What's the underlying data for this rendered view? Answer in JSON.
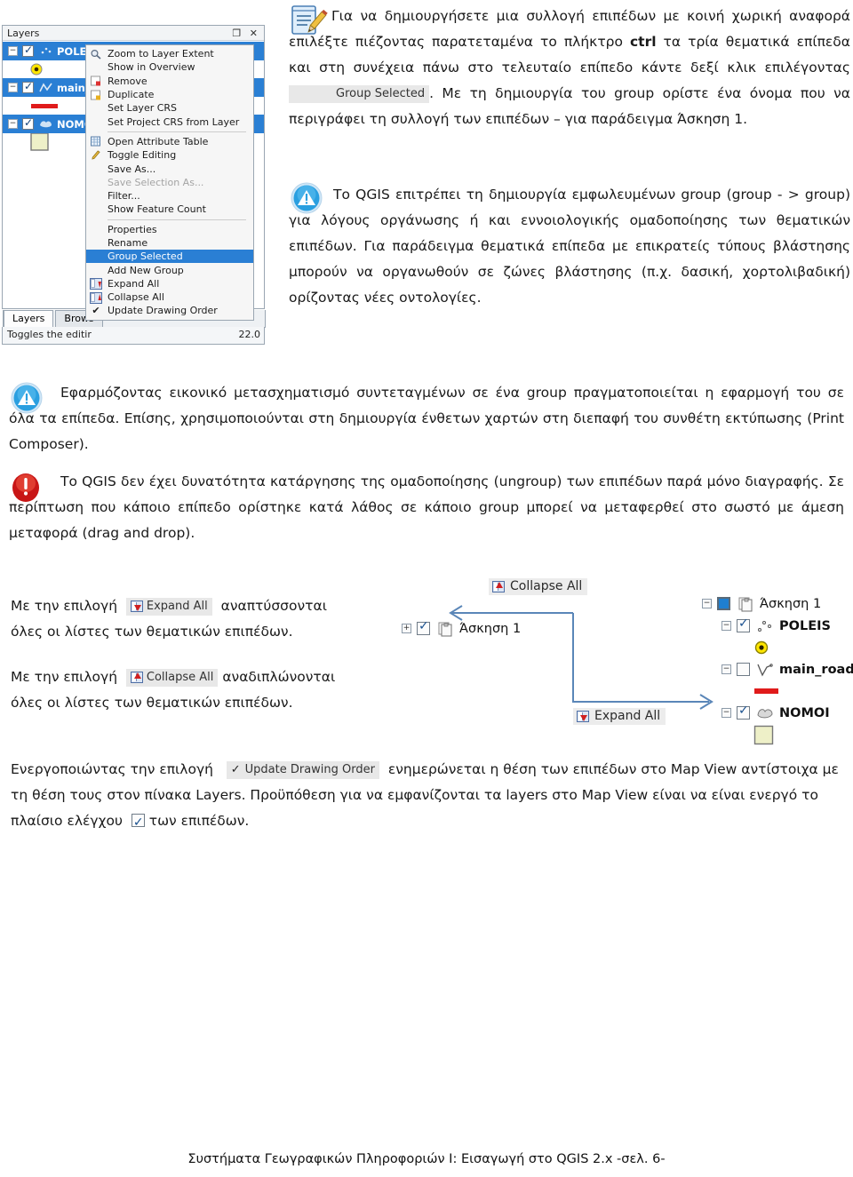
{
  "qgis_panel": {
    "title": "Layers",
    "win_buttons": "❐ ✕",
    "layers": [
      {
        "name": "POLEI",
        "icon": "point-layer-icon",
        "selected": true,
        "symbol": "point-symbol"
      },
      {
        "name": "main_",
        "icon": "line-layer-icon",
        "selected": true,
        "symbol": "line-symbol"
      },
      {
        "name": "NOMO",
        "icon": "polygon-layer-icon",
        "selected": true,
        "symbol": "polygon-symbol"
      }
    ],
    "tabs": [
      "Layers",
      "Brows"
    ],
    "status_left": "Toggles the editir",
    "status_right": "22.0"
  },
  "context_menu": {
    "items": [
      {
        "label": "Zoom to Layer Extent",
        "icon": "magnifier-icon",
        "state": "normal"
      },
      {
        "label": "Show in Overview",
        "icon": "",
        "state": "normal"
      },
      {
        "label": "Remove",
        "icon": "remove-icon",
        "state": "normal"
      },
      {
        "label": "Duplicate",
        "icon": "duplicate-icon",
        "state": "normal"
      },
      {
        "label": "Set Layer CRS",
        "icon": "",
        "state": "normal"
      },
      {
        "label": "Set Project CRS from Layer",
        "icon": "",
        "state": "normal"
      },
      {
        "separator": true
      },
      {
        "label": "Open Attribute Table",
        "icon": "table-icon",
        "state": "normal"
      },
      {
        "label": "Toggle Editing",
        "icon": "pencil-icon",
        "state": "normal"
      },
      {
        "label": "Save As...",
        "icon": "",
        "state": "normal"
      },
      {
        "label": "Save Selection As...",
        "icon": "",
        "state": "disabled"
      },
      {
        "label": "Filter...",
        "icon": "",
        "state": "normal"
      },
      {
        "label": "Show Feature Count",
        "icon": "",
        "state": "normal"
      },
      {
        "separator": true
      },
      {
        "label": "Properties",
        "icon": "",
        "state": "normal"
      },
      {
        "label": "Rename",
        "icon": "",
        "state": "normal"
      },
      {
        "label": "Group Selected",
        "icon": "",
        "state": "highlighted"
      },
      {
        "label": "Add New Group",
        "icon": "",
        "state": "normal"
      },
      {
        "label": "Expand All",
        "icon": "expand-all-icon",
        "state": "normal"
      },
      {
        "label": "Collapse All",
        "icon": "collapse-all-icon",
        "state": "normal"
      },
      {
        "label": "Update Drawing Order",
        "icon": "check-mark",
        "state": "checked"
      }
    ]
  },
  "paragraphs": {
    "p1_icon": "note-pencil-icon",
    "p1_a": "Για να δημιουργήσετε μια συλλογή επιπέδων με κοινή χωρική αναφορά επιλέξτε πιέζοντας παρατεταμένα το πλήκτρο ",
    "p1_bold": "ctrl",
    "p1_b": " τα τρία θεματικά επίπεδα και στη συνέχεια πάνω στο τελευταίο επίπεδο κάντε δεξί κλικ επιλέγοντας ",
    "p1_chip": "Group Selected",
    "p1_c": ". Με τη δημιουργία του group ορίστε ένα όνομα που να περιγράφει τη συλλογή των επιπέδων – για παράδειγμα Άσκηση 1.",
    "p2_icon": "info-warning-icon",
    "p2": "Το QGIS επιτρέπει τη δημιουργία εμφωλευμένων group (group - > group) για λόγους οργάνωσης ή και εννοιολογικής ομαδοποίησης των θεματικών επιπέδων. Για παράδειγμα θεματικά επίπεδα με επικρατείς τύπους βλάστησης μπορούν να οργανωθούν σε ζώνες βλάστησης (π.χ. δασική, χορτολιβαδική) ορίζοντας νέες οντολογίες.",
    "p3_icon": "info-warning-icon",
    "p3": "Εφαρμόζοντας εικονικό μετασχηματισμό συντεταγμένων σε ένα group πραγματοποιείται η εφαρμογή του σε όλα τα επίπεδα. Επίσης, χρησιμοποιούνται στη δημιουργία ένθετων χαρτών στη διεπαφή του συνθέτη εκτύπωσης (Print Composer).",
    "p4_icon": "error-alert-icon",
    "p4": "Το QGIS δεν έχει δυνατότητα κατάργησης της ομαδοποίησης (ungroup) των επιπέδων παρά μόνο διαγραφής. Σε περίπτωση που κάποιο επίπεδο ορίστηκε κατά λάθος σε κάποιο group μπορεί να μεταφερθεί στο σωστό με άμεση μεταφορά (drag and drop).",
    "p5_a": "Με την επιλογή",
    "p5_chip": "Expand All",
    "p5_b": "αναπτύσσονται",
    "p5_c": "όλες οι λίστες των θεματικών επιπέδων.",
    "p6_a": "Με την επιλογή",
    "p6_chip": "Collapse All",
    "p6_b": "αναδιπλώνονται",
    "p6_c": "όλες οι λίστες των θεματικών επιπέδων.",
    "p7_a": "Ενεργοποιώντας την επιλογή",
    "p7_chip": "Update Drawing Order",
    "p7_b": "ενημερώνεται η θέση των επιπέδων στο Map View αντίστοιχα με τη θέση τους στον πίνακα Layers. Προϋπόθεση για να εμφανίζονται τα layers στο Map View είναι να είναι ενεργό το πλαίσιο ελέγχου",
    "p7_c": "των επιπέδων."
  },
  "figure": {
    "collapse_all_label": "Collapse All",
    "expand_all_label": "Expand All",
    "collapsed_tree": {
      "name": "Άσκηση 1",
      "expander": "+"
    },
    "expanded_tree": [
      {
        "name": "Άσκηση 1",
        "expander": "−",
        "check": "solid",
        "icon": "group-icon",
        "bold": false
      },
      {
        "name": "POLEIS",
        "expander": "−",
        "check": "on",
        "icon": "point-layer-icon",
        "bold": true
      },
      {
        "name": "main_road",
        "expander": "−",
        "check": "off",
        "icon": "line-layer-icon",
        "bold": true
      },
      {
        "name": "NOMOI",
        "expander": "−",
        "check": "on",
        "icon": "polygon-layer-icon",
        "bold": true
      }
    ]
  },
  "footer": "Συστήματα Γεωγραφικών Πληροφοριών Ι: Εισαγωγή στο QGIS 2.x   -σελ. 6-"
}
